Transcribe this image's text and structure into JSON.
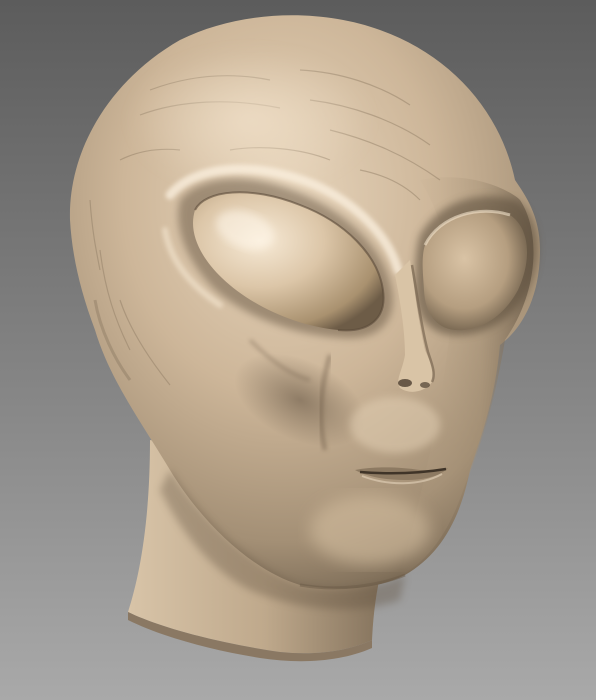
{
  "scene": {
    "subject": "alien-head-sculpt",
    "material": "clay",
    "colors": {
      "background_top": "#5c5c5c",
      "background_bottom": "#a8a8a8",
      "skin_light": "#f4e6d2",
      "skin_mid": "#cdb89c",
      "skin_shadow": "#7a6a56",
      "skin_deep": "#4f4436"
    }
  }
}
